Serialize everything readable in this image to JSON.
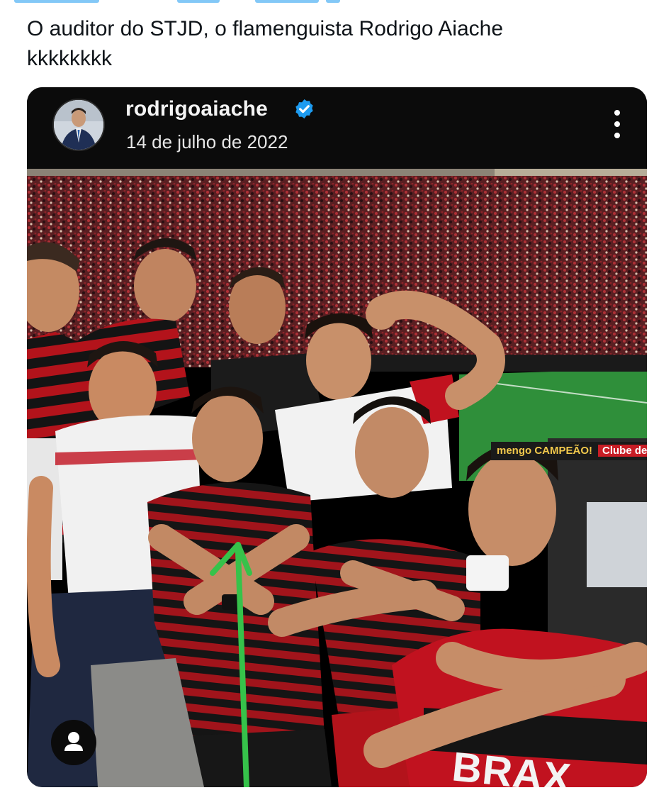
{
  "tweet": {
    "text_line1": "O auditor do STJD, o flamenguista Rodrigo Aiache",
    "text_line2": "kkkkkkkk"
  },
  "instagram_post": {
    "username": "rodrigoaiache",
    "date": "14 de julho de 2022",
    "verified": true,
    "icons": {
      "verified": "verified-badge-icon",
      "more": "more-vertical-icon",
      "user_tag": "person-icon"
    }
  },
  "photo": {
    "banner_text_1": "mengo CAMPEÃO!",
    "banner_text_2": "Clube de Regatas",
    "jersey_text": "BRAX",
    "annotation": "green-arrow-pointing-up"
  },
  "colors": {
    "accent_blue": "#1d9bf0",
    "flamengo_red": "#c81d25",
    "flamengo_black": "#111111",
    "annotation_green": "#36c24a",
    "pitch_green": "#2f8f3a"
  }
}
